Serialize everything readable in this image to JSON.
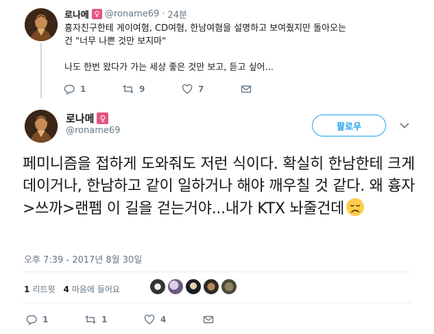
{
  "parent_tweet": {
    "name": "로나메",
    "badge": "♀",
    "handle": "@roname69",
    "dot": "·",
    "time": "24분",
    "text": "흉자친구한테 게이여혐, CD여혐, 한남여혐을 설명하고 보여줬지만 돌아오는\n건 \"너무 나쁜 것만 보지마\"\n\n나도 한번 왔다가 가는 세상 좋은 것만 보고, 듣고 싶어...",
    "replies": "1",
    "retweets": "9",
    "likes": "7"
  },
  "main_tweet": {
    "name": "로나메",
    "badge": "♀",
    "handle": "@roname69",
    "follow_label": "팔로우",
    "text": "페미니즘을 접하게 도와줘도 저런 식이다. 확실히 한남한테 크게 데이거나, 한남하고 같이 일하거나 해야 깨우칠 것 같다. 왜 흉자>쓰까>랜펨 이 길을 걷는거야...내가 KTX 놔줄건데",
    "emoji": "disappointed-face",
    "date": "오후 7:39 - 2017년 8월 30일",
    "retweet_count": "1",
    "retweet_label": "리트윗",
    "like_count": "4",
    "like_label": "마음에 들어요",
    "replies": "1",
    "retweets": "1",
    "likes": "4"
  },
  "colors": {
    "accent": "#1da1f2",
    "muted": "#657786",
    "badge": "#e75480",
    "divider": "#e6ecf0"
  }
}
